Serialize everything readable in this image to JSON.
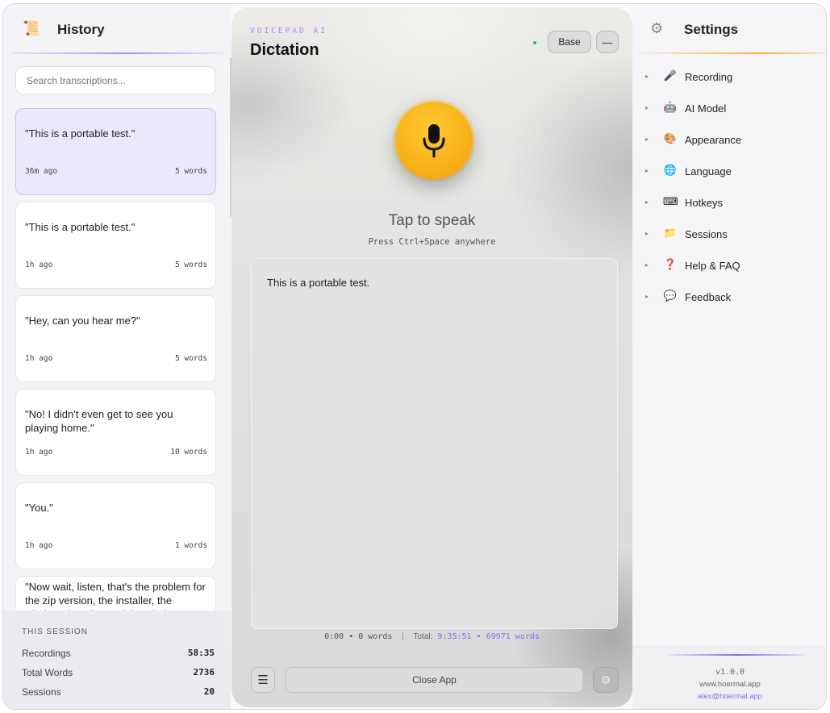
{
  "history": {
    "title": "History",
    "search_placeholder": "Search transcriptions...",
    "items": [
      {
        "text": "\"This is a portable test.\"",
        "time": "36m ago",
        "words": "5 words",
        "active": true
      },
      {
        "text": "\"This is a portable test.\"",
        "time": "1h ago",
        "words": "5 words"
      },
      {
        "text": "\"Hey, can you hear me?\"",
        "time": "1h ago",
        "words": "5 words"
      },
      {
        "text": "\"No! I didn't even get to see you playing home.\"",
        "time": "1h ago",
        "words": "10 words"
      },
      {
        "text": "\"You.\"",
        "time": "1h ago",
        "words": "1 words"
      },
      {
        "text": "\"Now wait, listen, that's the problem for the zip version, the installer, the windows installer and the windows xe"
      }
    ],
    "session": {
      "label": "THIS SESSION",
      "rows": [
        {
          "label": "Recordings",
          "value": "58:35"
        },
        {
          "label": "Total Words",
          "value": "2736"
        },
        {
          "label": "Sessions",
          "value": "20"
        }
      ]
    }
  },
  "dictation": {
    "brand": "VOICEPAD AI",
    "title": "Dictation",
    "model_button": "Base",
    "minimize_button": "—",
    "tap_text": "Tap to speak",
    "hotkey_hint": "Press Ctrl+Space anywhere",
    "transcript": "This is a portable test.",
    "stats": {
      "current": "0:00 • 0 words",
      "separator": "|",
      "total_label": "Total:",
      "total_time": "9:35:51",
      "dot": "•",
      "total_words": "69971 words"
    },
    "menu_glyph": "☰",
    "close_label": "Close App",
    "gear_glyph": "⚙"
  },
  "settings": {
    "title": "Settings",
    "items": [
      {
        "label": "Recording",
        "icon": "microphone-icon",
        "glyph": "🎤"
      },
      {
        "label": "AI Model",
        "icon": "robot-icon",
        "glyph": "🤖"
      },
      {
        "label": "Appearance",
        "icon": "palette-icon",
        "glyph": "🎨"
      },
      {
        "label": "Language",
        "icon": "globe-icon",
        "glyph": "🌐"
      },
      {
        "label": "Hotkeys",
        "icon": "keyboard-icon",
        "glyph": "⌨"
      },
      {
        "label": "Sessions",
        "icon": "folder-icon",
        "glyph": "📁"
      },
      {
        "label": "Help & FAQ",
        "icon": "question-icon",
        "glyph": "❓"
      },
      {
        "label": "Feedback",
        "icon": "speech-bubble-icon",
        "glyph": "💬"
      }
    ],
    "arrow": "▸",
    "footer": {
      "version": "v1.0.0",
      "website": "www.hoermal.app",
      "email": "alex@hoermal.app"
    }
  },
  "colors": {
    "accent_purple": "#a78bfa",
    "mic_yellow": "#f7ad14",
    "status_green": "#22c55e"
  }
}
